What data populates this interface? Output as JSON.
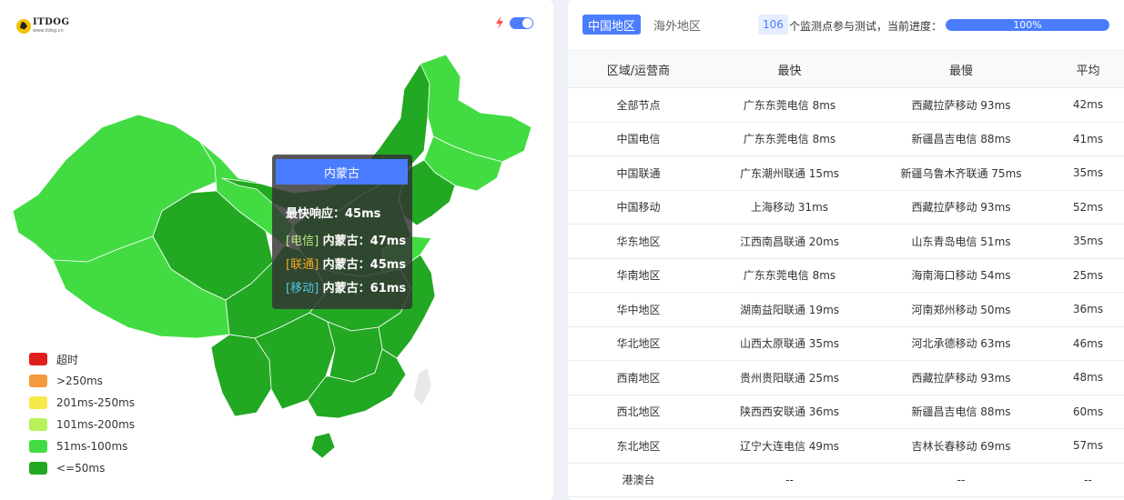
{
  "logo": {
    "title": "ITDOG",
    "subtitle": "www.itdog.cn"
  },
  "colors": {
    "timeout": "#e01e1e",
    "over250": "#f59a3c",
    "r201_250": "#f7e84a",
    "r101_200": "#b8f25a",
    "r51_100": "#42dc42",
    "le50": "#22a822",
    "accent": "#4a7cff"
  },
  "icons": {
    "flash": "lightning-bolt",
    "toggle": "switch-on"
  },
  "tooltip": {
    "title": "内蒙古",
    "fastest_label": "最快响应：",
    "fastest_value": "45ms",
    "rows": [
      {
        "tag": "[电信]",
        "text": " 内蒙古：47ms",
        "color": "#b8e986"
      },
      {
        "tag": "[联通]",
        "text": " 内蒙古：45ms",
        "color": "#f5a623"
      },
      {
        "tag": "[移动]",
        "text": " 内蒙古：61ms",
        "color": "#50c8e8"
      }
    ]
  },
  "legend": [
    {
      "label": "超时",
      "color": "#e01e1e"
    },
    {
      "label": ">250ms",
      "color": "#f59a3c"
    },
    {
      "label": "201ms-250ms",
      "color": "#f7e84a"
    },
    {
      "label": "101ms-200ms",
      "color": "#b8f25a"
    },
    {
      "label": "51ms-100ms",
      "color": "#42dc42"
    },
    {
      "label": "<=50ms",
      "color": "#22a822"
    }
  ],
  "tabs": [
    {
      "label": "中国地区",
      "active": true
    },
    {
      "label": "海外地区",
      "active": false
    }
  ],
  "monitor": {
    "count": "106",
    "count_text": "个监测点参与测试，当前进度：",
    "progress": 100,
    "progress_label": "100%"
  },
  "table": {
    "headers": [
      "区域/运营商",
      "最快",
      "最慢",
      "平均"
    ],
    "rows": [
      [
        "全部节点",
        "广东东莞电信 8ms",
        "西藏拉萨移动 93ms",
        "42ms"
      ],
      [
        "中国电信",
        "广东东莞电信 8ms",
        "新疆昌吉电信 88ms",
        "41ms"
      ],
      [
        "中国联通",
        "广东潮州联通 15ms",
        "新疆乌鲁木齐联通 75ms",
        "35ms"
      ],
      [
        "中国移动",
        "上海移动 31ms",
        "西藏拉萨移动 93ms",
        "52ms"
      ],
      [
        "华东地区",
        "江西南昌联通 20ms",
        "山东青岛电信 51ms",
        "35ms"
      ],
      [
        "华南地区",
        "广东东莞电信 8ms",
        "海南海口移动 54ms",
        "25ms"
      ],
      [
        "华中地区",
        "湖南益阳联通 19ms",
        "河南郑州移动 50ms",
        "36ms"
      ],
      [
        "华北地区",
        "山西太原联通 35ms",
        "河北承德移动 63ms",
        "46ms"
      ],
      [
        "西南地区",
        "贵州贵阳联通 25ms",
        "西藏拉萨移动 93ms",
        "48ms"
      ],
      [
        "西北地区",
        "陕西西安联通 36ms",
        "新疆昌吉电信 88ms",
        "60ms"
      ],
      [
        "东北地区",
        "辽宁大连电信 49ms",
        "吉林长春移动 69ms",
        "57ms"
      ],
      [
        "港澳台",
        "--",
        "--",
        "--"
      ]
    ]
  }
}
